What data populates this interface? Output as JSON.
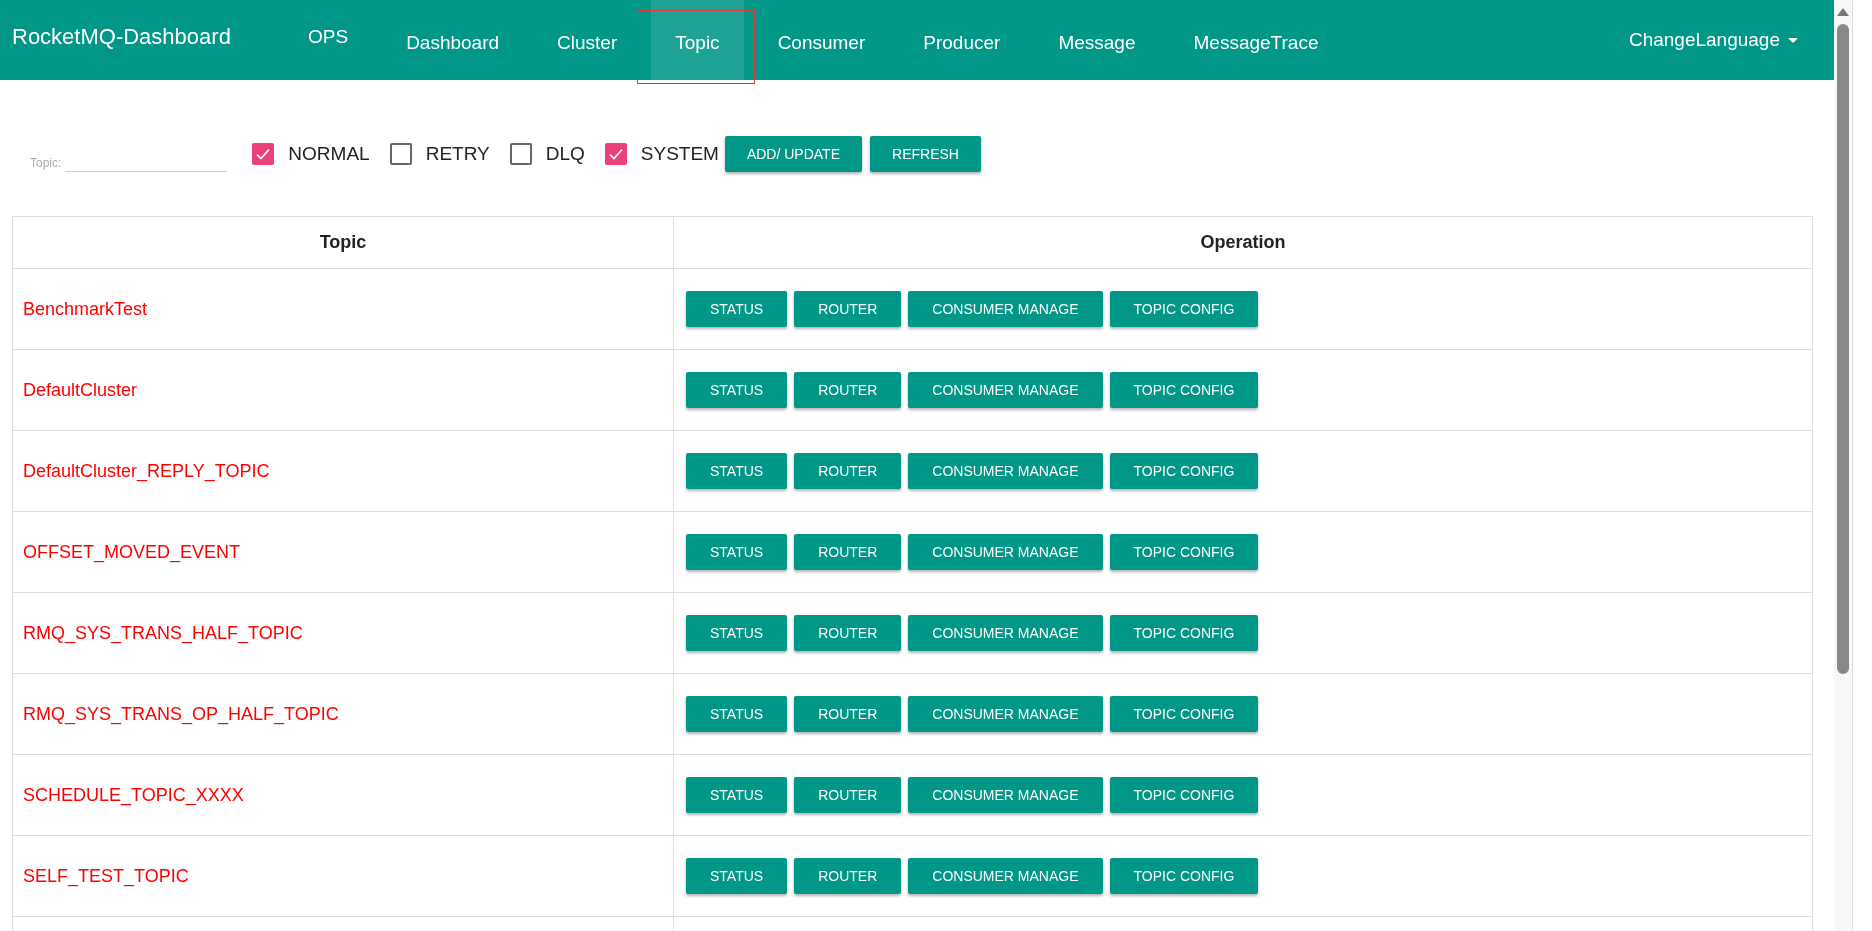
{
  "navbar": {
    "brand": "RocketMQ-Dashboard",
    "items": [
      {
        "label": "OPS",
        "selected": false,
        "annotated": false
      },
      {
        "label": "Dashboard",
        "selected": false,
        "annotated": false
      },
      {
        "label": "Cluster",
        "selected": false,
        "annotated": false
      },
      {
        "label": "Topic",
        "selected": true,
        "annotated": true
      },
      {
        "label": "Consumer",
        "selected": false,
        "annotated": false
      },
      {
        "label": "Producer",
        "selected": false,
        "annotated": false
      },
      {
        "label": "Message",
        "selected": false,
        "annotated": false
      },
      {
        "label": "MessageTrace",
        "selected": false,
        "annotated": false
      }
    ],
    "language_menu": "ChangeLanguage"
  },
  "filter": {
    "topic_label": "Topic:",
    "checkboxes": [
      {
        "label": "NORMAL",
        "checked": true
      },
      {
        "label": "RETRY",
        "checked": false
      },
      {
        "label": "DLQ",
        "checked": false
      },
      {
        "label": "SYSTEM",
        "checked": true
      }
    ],
    "buttons": [
      "ADD/ UPDATE",
      "REFRESH"
    ]
  },
  "table": {
    "columns": [
      "Topic",
      "Operation"
    ],
    "rows": [
      {
        "topic": "BenchmarkTest",
        "actions": [
          "STATUS",
          "ROUTER",
          "CONSUMER MANAGE",
          "TOPIC CONFIG"
        ]
      },
      {
        "topic": "DefaultCluster",
        "actions": [
          "STATUS",
          "ROUTER",
          "CONSUMER MANAGE",
          "TOPIC CONFIG"
        ]
      },
      {
        "topic": "DefaultCluster_REPLY_TOPIC",
        "actions": [
          "STATUS",
          "ROUTER",
          "CONSUMER MANAGE",
          "TOPIC CONFIG"
        ]
      },
      {
        "topic": "OFFSET_MOVED_EVENT",
        "actions": [
          "STATUS",
          "ROUTER",
          "CONSUMER MANAGE",
          "TOPIC CONFIG"
        ]
      },
      {
        "topic": "RMQ_SYS_TRANS_HALF_TOPIC",
        "actions": [
          "STATUS",
          "ROUTER",
          "CONSUMER MANAGE",
          "TOPIC CONFIG"
        ]
      },
      {
        "topic": "RMQ_SYS_TRANS_OP_HALF_TOPIC",
        "actions": [
          "STATUS",
          "ROUTER",
          "CONSUMER MANAGE",
          "TOPIC CONFIG"
        ]
      },
      {
        "topic": "SCHEDULE_TOPIC_XXXX",
        "actions": [
          "STATUS",
          "ROUTER",
          "CONSUMER MANAGE",
          "TOPIC CONFIG"
        ]
      },
      {
        "topic": "SELF_TEST_TOPIC",
        "actions": [
          "STATUS",
          "ROUTER",
          "CONSUMER MANAGE",
          "TOPIC CONFIG"
        ]
      }
    ]
  }
}
